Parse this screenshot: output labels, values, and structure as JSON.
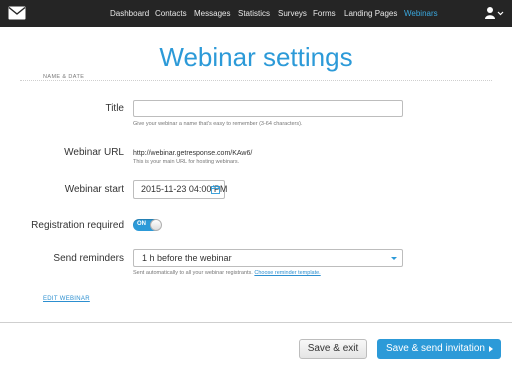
{
  "topbar": {
    "nav": [
      "Dashboard",
      "Contacts",
      "Messages",
      "Statistics",
      "Surveys",
      "Forms",
      "Landing Pages",
      "Webinars"
    ],
    "active": "Webinars"
  },
  "page": {
    "title": "Webinar settings",
    "section_label": "NAME & DATE"
  },
  "form": {
    "title_label": "Title",
    "title_value": "",
    "title_hint": "Give your webinar a name that's easy to remember (3-64 characters).",
    "url_label": "Webinar URL",
    "url_value": "http://webinar.getresponse.com/KAw6/",
    "url_hint": "This is your main URL for hosting webinars.",
    "start_label": "Webinar start",
    "start_value": "2015-11-23 04:00 PM",
    "registration_label": "Registration required",
    "registration_toggle": "ON",
    "reminders_label": "Send reminders",
    "reminders_value": "1 h before the webinar",
    "reminders_hint": "Sent automatically to all your webinar registrants.",
    "reminders_link": "Choose reminder template."
  },
  "edit_link": "EDIT WEBINAR",
  "buttons": {
    "save_exit": "Save & exit",
    "save_send": "Save & send invitation"
  },
  "colors": {
    "accent": "#2c9ad8",
    "topbar": "#252525"
  }
}
